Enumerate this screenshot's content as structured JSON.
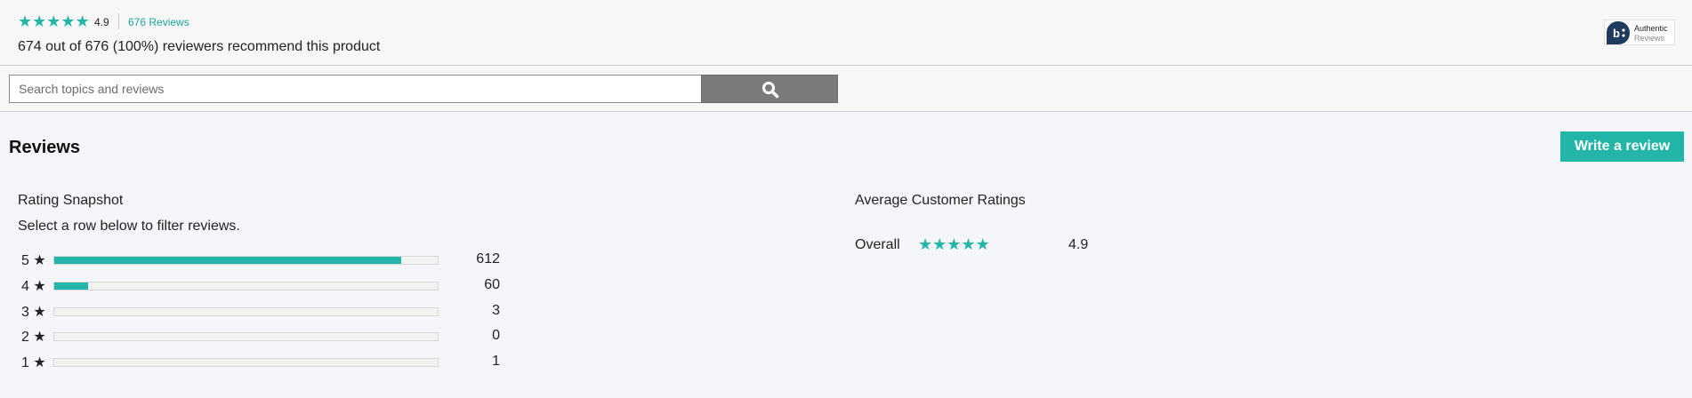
{
  "summary": {
    "average_rating": "4.9",
    "reviews_link": "676 Reviews",
    "recommend_text": "674 out of 676 (100%) reviewers recommend this product",
    "star_icon": "star-icon",
    "star_color": "#22b5a8"
  },
  "badge": {
    "line1": "Authentic",
    "line2": "Reviews",
    "icon": "bazaarvoice-logo-icon",
    "color": "#1f3a5f"
  },
  "search": {
    "placeholder": "Search topics and reviews",
    "value": "",
    "icon": "search-icon"
  },
  "reviews": {
    "heading": "Reviews",
    "write_label": "Write a review"
  },
  "snapshot": {
    "title": "Rating Snapshot",
    "subtitle": "Select a row below to filter reviews.",
    "rows": [
      {
        "label": "5 ★",
        "count": "612",
        "fraction": 0.905
      },
      {
        "label": "4 ★",
        "count": "60",
        "fraction": 0.089
      },
      {
        "label": "3 ★",
        "count": "3",
        "fraction": 0.0
      },
      {
        "label": "2 ★",
        "count": "0",
        "fraction": 0.0
      },
      {
        "label": "1 ★",
        "count": "1",
        "fraction": 0.0
      }
    ]
  },
  "average": {
    "title": "Average Customer Ratings",
    "overall_label": "Overall",
    "overall_value": "4.9",
    "overall_stars": 4.9
  }
}
